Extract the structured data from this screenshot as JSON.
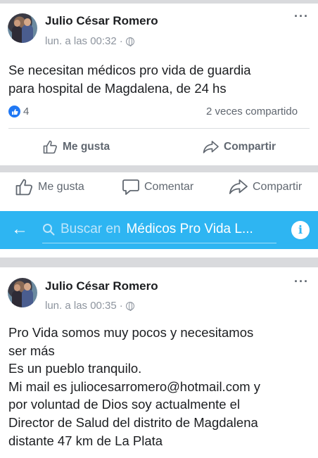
{
  "post1": {
    "author": "Julio César Romero",
    "time": "lun. a las 00:32",
    "separator": "·",
    "text_lines": [
      "Se necesitan médicos pro vida de guardia",
      "para hospital de Magdalena, de 24 hs"
    ],
    "likes_count": "4",
    "shares": "2 veces compartido",
    "actions": {
      "like": "Me gusta",
      "share": "Compartir"
    }
  },
  "action_bar": {
    "like": "Me gusta",
    "comment": "Comentar",
    "share": "Compartir"
  },
  "search": {
    "prefix": "Buscar en",
    "group": "Médicos Pro Vida L...",
    "info": "i"
  },
  "post2": {
    "author": "Julio César Romero",
    "time": "lun. a las 00:35",
    "separator": "·",
    "text_lines": [
      "Pro Vida somos muy pocos y necesitamos",
      "ser más",
      "Es un pueblo tranquilo.",
      "Mi mail es juliocesarromero@hotmail.com y",
      "por voluntad de Dios soy actualmente el",
      "Director de Salud del distrito de Magdalena",
      "distante 47 km de La Plata"
    ]
  },
  "colors": {
    "facebook_blue": "#2078f4",
    "search_bar": "#2eb5f2",
    "gray_text": "#606770"
  }
}
